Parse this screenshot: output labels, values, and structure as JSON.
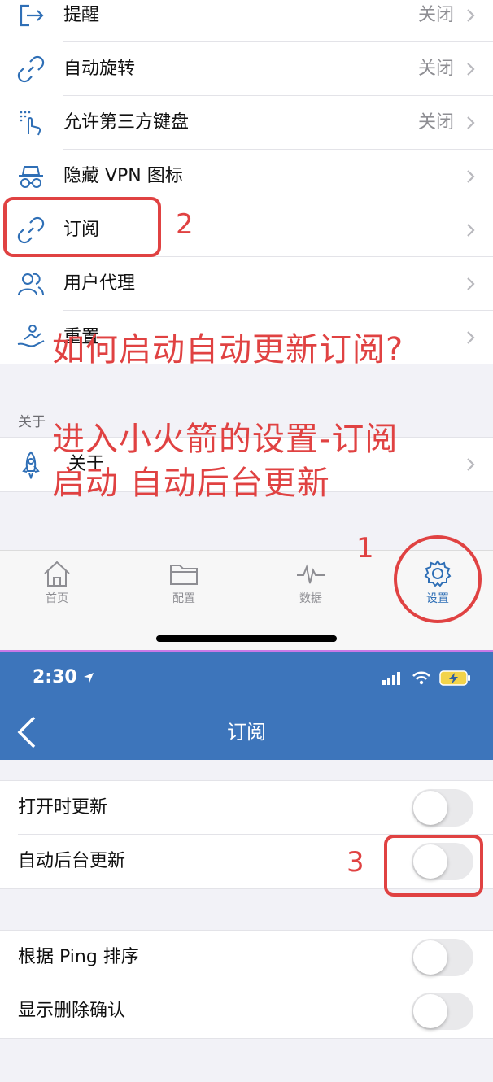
{
  "settings_list": [
    {
      "label": "提醒",
      "value": "关闭",
      "icon": "exit-arrow-icon"
    },
    {
      "label": "自动旋转",
      "value": "关闭",
      "icon": "link-icon"
    },
    {
      "label": "允许第三方键盘",
      "value": "关闭",
      "icon": "tap-gesture-icon"
    },
    {
      "label": "隐藏 VPN 图标",
      "value": "",
      "icon": "incognito-icon"
    },
    {
      "label": "订阅",
      "value": "",
      "icon": "link-icon"
    },
    {
      "label": "用户代理",
      "value": "",
      "icon": "users-icon"
    },
    {
      "label": "重置",
      "value": "",
      "icon": "reset-hand-icon"
    }
  ],
  "about_section": {
    "header": "关于",
    "item_label": "关于",
    "icon": "rocket-icon"
  },
  "tabs": [
    {
      "label": "首页",
      "icon": "home-icon",
      "active": false
    },
    {
      "label": "配置",
      "icon": "folder-icon",
      "active": false
    },
    {
      "label": "数据",
      "icon": "pulse-icon",
      "active": false
    },
    {
      "label": "设置",
      "icon": "gear-icon",
      "active": true
    }
  ],
  "overlay": {
    "question": "如何启动自动更新订阅?",
    "line2": "进入小火箭的设置-订阅",
    "line3": "启动 自动后台更新"
  },
  "annotations": {
    "step1": "1",
    "step2": "2",
    "step3": "3",
    "color": "#e04242"
  },
  "status_bar": {
    "time": "2:30"
  },
  "nav": {
    "title": "订阅",
    "color": "#3d75bb"
  },
  "subscription_group1": [
    {
      "label": "打开时更新",
      "on": false
    },
    {
      "label": "自动后台更新",
      "on": false
    }
  ],
  "subscription_group2": [
    {
      "label": "根据 Ping 排序",
      "on": false
    },
    {
      "label": "显示删除确认",
      "on": false
    }
  ]
}
